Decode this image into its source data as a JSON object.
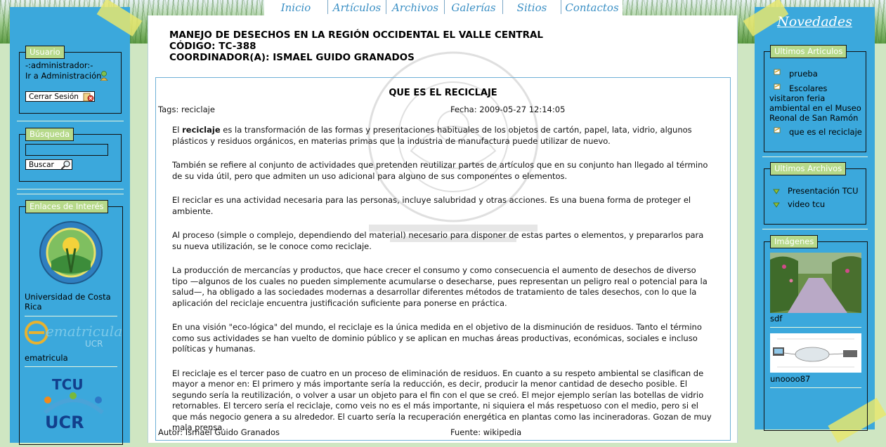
{
  "nav": {
    "items": [
      "Inicio",
      "Artículos",
      "Archivos",
      "Galerías",
      "Sitios",
      "Contactos"
    ]
  },
  "header": {
    "line1": "MANEJO DE DESECHOS EN LA REGIÓN OCCIDENTAL EL VALLE CENTRAL",
    "line2": "CÓDIGO: TC-388",
    "line3": "COORDINADOR(A): ISMAEL GUIDO GRANADOS"
  },
  "article": {
    "title": "QUE ES EL RECICLAJE",
    "tags": "Tags: reciclaje",
    "fecha": "Fecha: 2009-05-27 12:14:05",
    "p1_pre": "El ",
    "p1_bold": "reciclaje",
    "p1_post": " es la transformación de las formas y presentaciones habituales de los objetos de cartón, papel, lata, vidrio, algunos plásticos y residuos orgánicos, en materias primas que la industria de manufactura puede utilizar de nuevo.",
    "p2": "También se refiere al conjunto de actividades que pretenden reutilizar partes de artículos que en su conjunto han llegado al término de su vida útil, pero que admiten un uso adicional para alguno de sus componentes o elementos.",
    "p3": "El reciclar es una actividad necesaria para las personas, incluye salubridad y otras acciones. Es una buena forma de proteger el ambiente.",
    "p4": "Al proceso (simple o complejo, dependiendo del material) necesario para disponer de estas partes o elementos, y prepararlos para su nueva utilización, se le conoce como reciclaje.",
    "p5": "La producción de mercancías y productos, que hace crecer el consumo y como consecuencia el aumento de desechos de diverso tipo —algunos de los cuales no pueden simplemente acumularse o desecharse, pues representan un peligro real o potencial para la salud—, ha obligado a las sociedades modernas a desarrollar diferentes métodos de tratamiento de tales desechos, con lo que la aplicación del reciclaje encuentra justificación suficiente para ponerse en práctica.",
    "p6": "En una visión \"eco-lógica\" del mundo, el reciclaje es la única medida en el objetivo de la disminución de residuos. Tanto el término como sus actividades se han vuelto de dominio público y se aplican en muchas áreas productivas, económicas, sociales e incluso políticas y humanas.",
    "p7": "El reciclaje es el tercer paso de cuatro en un proceso de eliminación de residuos. En cuanto a su respeto ambiental se clasifican de mayor a menor en: El primero y más importante sería la reducción, es decir, producir la menor cantidad de desecho posible. El segundo sería la reutilización, o volver a usar un objeto para el fin con el que se creó. El mejor ejemplo serían las botellas de vidrio retornables. El tercero sería el reciclaje, como veis no es el más importante, ni siquiera el más respetuoso con el medio, pero si el que más negocio genera a su alrededor. El cuarto sería la recuperación energética en plantas como las incineradoras. Gozan de muy mala prensa.",
    "autor": "Autor: Ismael Guido Granados",
    "fuente": "Fuente: wikipedia"
  },
  "usuario": {
    "legend": "Usuario",
    "user": "-:administrador:-",
    "admin_link": "Ir a Administración",
    "logout": "Cerrar Sesión"
  },
  "busqueda": {
    "legend": "Búsqueda",
    "value": "",
    "button": "Buscar"
  },
  "enlaces": {
    "legend": "Enlaces de Interés",
    "ucr": "Universidad de Costa Rica",
    "ematricula_logo": "ematricula",
    "ematricula_logo_sub": "UCR",
    "ematricula": "ematricula",
    "tcu_top": "TCU",
    "tcu_bottom": "UCR"
  },
  "novedades": {
    "title": "Novedades",
    "articulos_legend": "Ultimos Articulos",
    "articulos": [
      "prueba",
      "Escolares visitaron feria ambiental en el Museo Reonal de San Ramón",
      "que es el reciclaje"
    ],
    "archivos_legend": "Ultimos Archivos",
    "archivos": [
      "Presentación TCU",
      "video tcu"
    ],
    "imagenes_legend": "Imágenes",
    "img1_caption": "sdf",
    "img2_caption": "unoooo87"
  },
  "colors": {
    "sidebar": "#3ba8dc",
    "legend_bg": "#b6d98a",
    "nav_text": "#3a8fc4"
  }
}
